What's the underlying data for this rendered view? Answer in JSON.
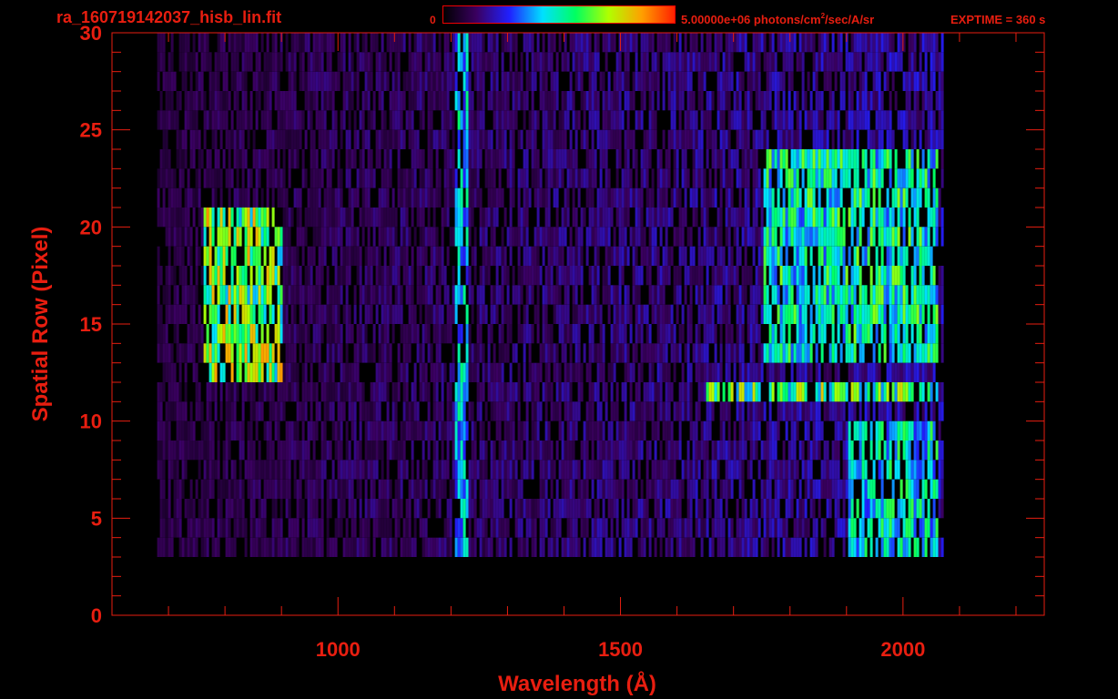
{
  "header": {
    "filename": "ra_160719142037_hisb_lin.fit",
    "colorbar_min": "0",
    "colorbar_max_label": "5.00000e+06 photons/cm",
    "colorbar_max_sup": "2",
    "colorbar_max_unit": "/sec/A/sr",
    "exptime": "EXPTIME = 360 s"
  },
  "colors": {
    "axis": "#e81e10",
    "background": "#000000",
    "colormap": [
      "#000000",
      "#3a0060",
      "#2020ff",
      "#00e0ff",
      "#00ff60",
      "#b0ff00",
      "#ffa000",
      "#ff2000"
    ]
  },
  "chart_data": {
    "type": "heatmap",
    "title": "ra_160719142037_hisb_lin.fit",
    "xlabel": "Wavelength (Å)",
    "ylabel": "Spatial Row (Pixel)",
    "xlim": [
      600,
      2250
    ],
    "ylim": [
      0,
      30
    ],
    "xticks": [
      1000,
      1500,
      2000
    ],
    "yticks": [
      0,
      5,
      10,
      15,
      20,
      25,
      30
    ],
    "value_range": [
      0,
      5000000
    ],
    "value_unit": "photons/cm^2/sec/A/sr",
    "data_extent": {
      "wavelength": [
        680,
        2070
      ],
      "rows": [
        3,
        30
      ]
    },
    "features": [
      {
        "wavelength": [
          760,
          900
        ],
        "rows": [
          12,
          21
        ],
        "level": 0.7
      },
      {
        "wavelength": [
          1205,
          1230
        ],
        "rows": [
          3,
          30
        ],
        "level": 0.45
      },
      {
        "wavelength": [
          1650,
          2060
        ],
        "rows": [
          11,
          12
        ],
        "level": 0.65
      },
      {
        "wavelength": [
          1750,
          2060
        ],
        "rows": [
          13,
          24
        ],
        "level": 0.55
      },
      {
        "wavelength": [
          1900,
          2060
        ],
        "rows": [
          3,
          10
        ],
        "level": 0.5
      }
    ]
  }
}
